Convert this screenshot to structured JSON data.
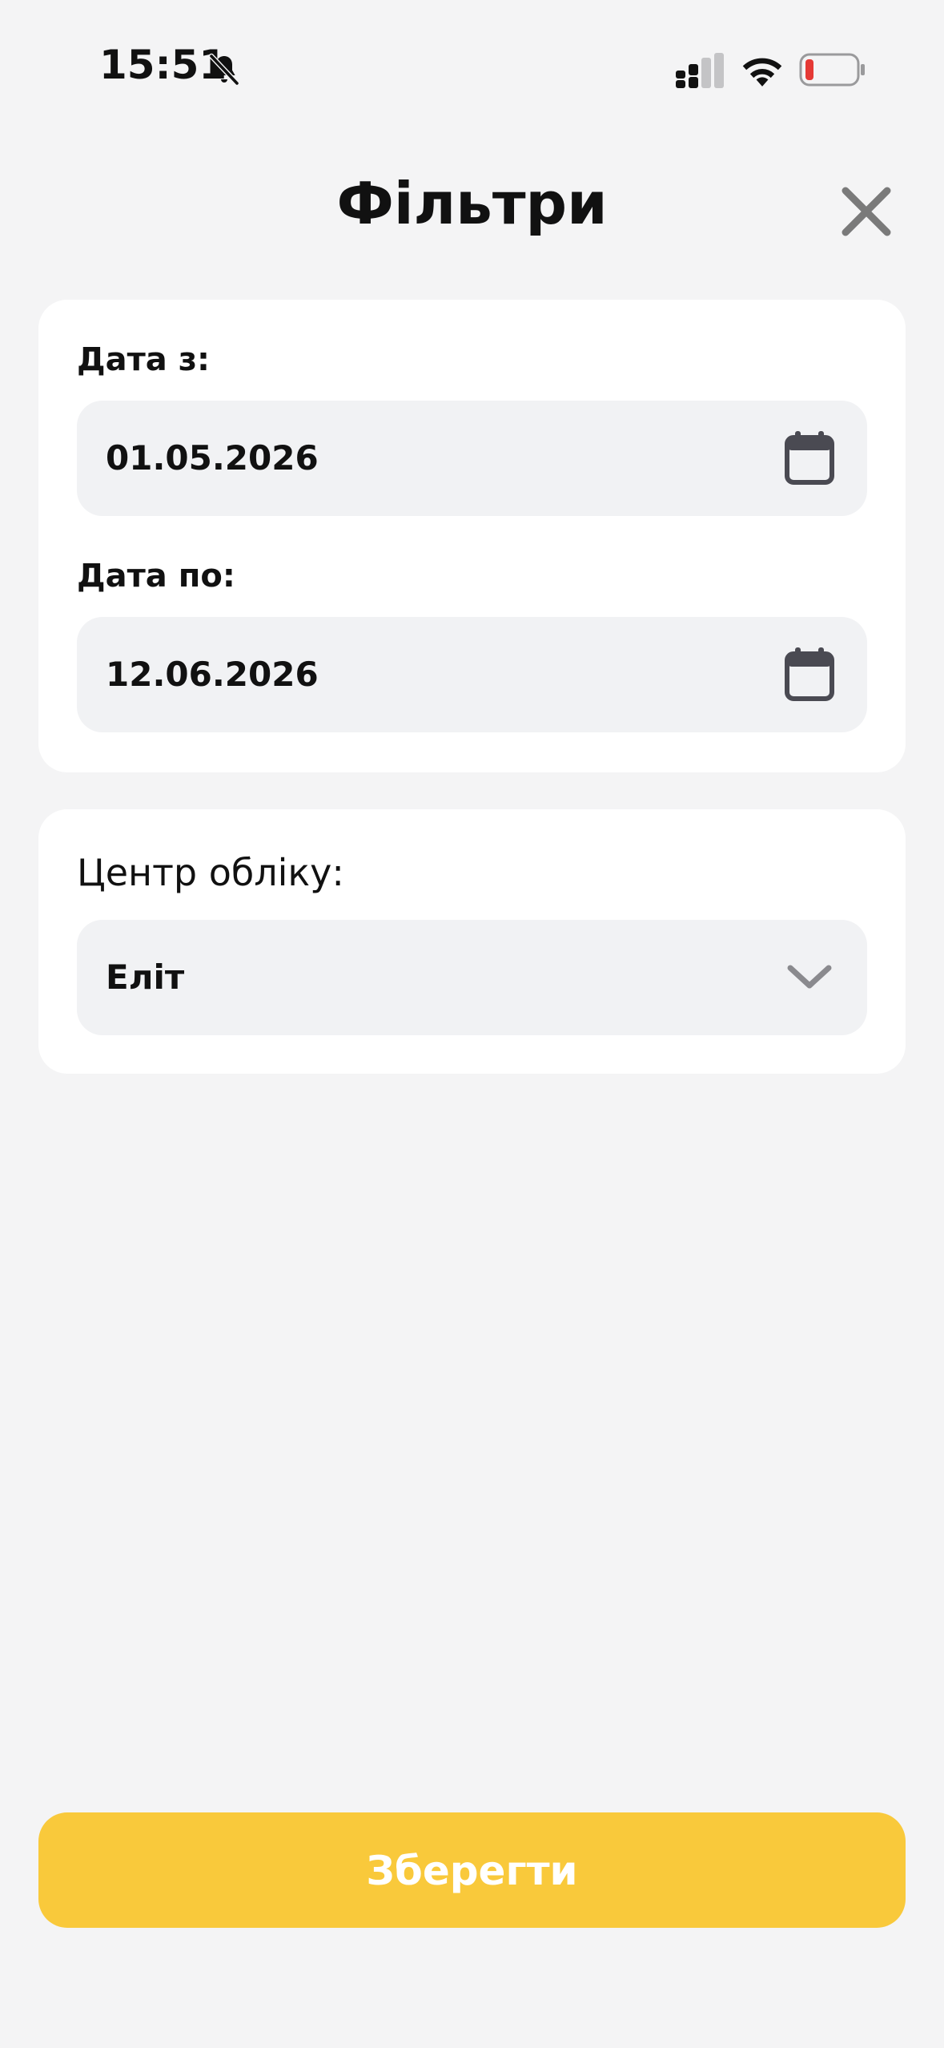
{
  "status_bar": {
    "time": "15:51",
    "icons": [
      "bell-slash-icon",
      "cellular-signal-icon",
      "wifi-icon",
      "battery-low-icon"
    ]
  },
  "header": {
    "title": "Фільтри",
    "close_icon": "close-icon"
  },
  "date_filter": {
    "from_label": "Дата з:",
    "from_value": "01.05.2026",
    "to_label": "Дата по:",
    "to_value": "12.06.2026",
    "icon": "calendar-icon"
  },
  "center_filter": {
    "label": "Центр обліку:",
    "selected": "Еліт",
    "icon": "chevron-down-icon"
  },
  "actions": {
    "save_label": "Зберегти"
  },
  "colors": {
    "background": "#f4f4f5",
    "card": "#ffffff",
    "field": "#f1f2f4",
    "accent": "#f9c93b",
    "battery_low": "#e53935"
  }
}
